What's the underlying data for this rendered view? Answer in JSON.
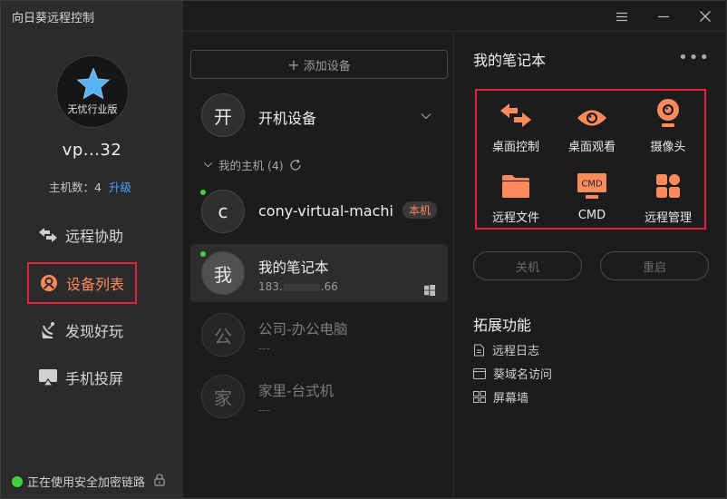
{
  "app": {
    "title": "向日葵远程控制"
  },
  "profile": {
    "badge": "无忧行业版",
    "username": "vp...32",
    "host_count_label": "主机数：4",
    "upgrade_label": "升级"
  },
  "nav": [
    {
      "label": "远程协助",
      "icon": "remote-assist-icon"
    },
    {
      "label": "设备列表",
      "icon": "device-list-icon",
      "active": true
    },
    {
      "label": "发现好玩",
      "icon": "discover-icon"
    },
    {
      "label": "手机投屏",
      "icon": "screen-cast-icon"
    }
  ],
  "status": {
    "secure_text": "正在使用安全加密链路"
  },
  "middle": {
    "add_device": "添加设备",
    "power_on_device": {
      "initial": "开",
      "name": "开机设备"
    },
    "group": {
      "label": "我的主机 (4)"
    },
    "devices": [
      {
        "initial": "c",
        "name": "cony-virtual-machi...",
        "tag": "本机",
        "online": true
      },
      {
        "initial": "我",
        "name": "我的笔记本",
        "ip_prefix": "183.",
        "ip_suffix": ".66",
        "online": true,
        "selected": true
      },
      {
        "initial": "公",
        "name": "公司-办公电脑",
        "sub": "---"
      },
      {
        "initial": "家",
        "name": "家里-台式机",
        "sub": "---"
      }
    ]
  },
  "right": {
    "device_title": "我的笔记本",
    "more": "•••",
    "functions": [
      {
        "label": "桌面控制",
        "icon": "desktop-control-icon"
      },
      {
        "label": "桌面观看",
        "icon": "eye-icon"
      },
      {
        "label": "摄像头",
        "icon": "camera-icon"
      },
      {
        "label": "远程文件",
        "icon": "folder-icon"
      },
      {
        "label": "CMD",
        "icon": "cmd-icon",
        "icon_text": "CMD"
      },
      {
        "label": "远程管理",
        "icon": "remote-manage-icon"
      }
    ],
    "shutdown": "关机",
    "restart": "重启",
    "extensions_title": "拓展功能",
    "extensions": [
      {
        "label": "远程日志",
        "icon": "log-icon"
      },
      {
        "label": "葵域名访问",
        "icon": "domain-icon"
      },
      {
        "label": "屏幕墙",
        "icon": "screen-wall-icon"
      }
    ]
  },
  "colors": {
    "accent": "#ff8a5c",
    "highlight_border": "#e0203c",
    "link": "#4aa3ff",
    "online": "#43d143"
  }
}
